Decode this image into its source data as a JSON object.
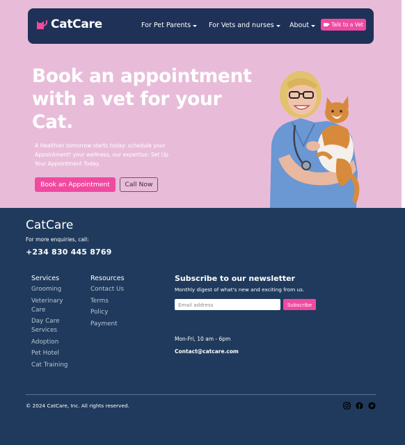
{
  "nav": {
    "brand": "CatCare",
    "links": [
      {
        "label": "For Pet Parents"
      },
      {
        "label": "For Vets and nurses"
      },
      {
        "label": "About"
      }
    ],
    "cta_label": "Talk to a Vet"
  },
  "hero": {
    "headline": "Book an appointment with a vet for your Cat.",
    "subtext": "A Healthier tomorrow starts today: schedule your Appointment! your wellness, our expertise: Set Up Your Appointment Today.",
    "primary_button": "Book an Appointment",
    "secondary_button": "Call Now"
  },
  "footer": {
    "brand": "CatCare",
    "enquiries": "For more enquiries, call:",
    "phone": "+234 830 445 8769",
    "services": {
      "title": "Services",
      "items": [
        "Grooming",
        "Veterinary Care",
        "Day Care Services",
        "Adoption",
        "Pet Hotel",
        "Cat Training"
      ]
    },
    "resources": {
      "title": "Resources",
      "items": [
        "Contact Us",
        "Terms",
        "Policy",
        "Payment"
      ]
    },
    "newsletter": {
      "title": "Subscribe to our newsletter",
      "subtitle": "Monthly digest of what's new and exciting from us.",
      "placeholder": "Email address",
      "button": "Subscribe"
    },
    "hours": "Mon-Fri, 10 am - 6pm",
    "email": "Contact@catcare.com",
    "copyright": "© 2024 CatCare, Inc. All rights reserved.",
    "social_icons": [
      "instagram-icon",
      "facebook-icon",
      "twitter-icon"
    ]
  },
  "colors": {
    "hero_bg": "#e8bcd9",
    "navy": "#1f3157",
    "footer_bg": "#1f3a5c",
    "accent_pink": "#f04aa0"
  }
}
